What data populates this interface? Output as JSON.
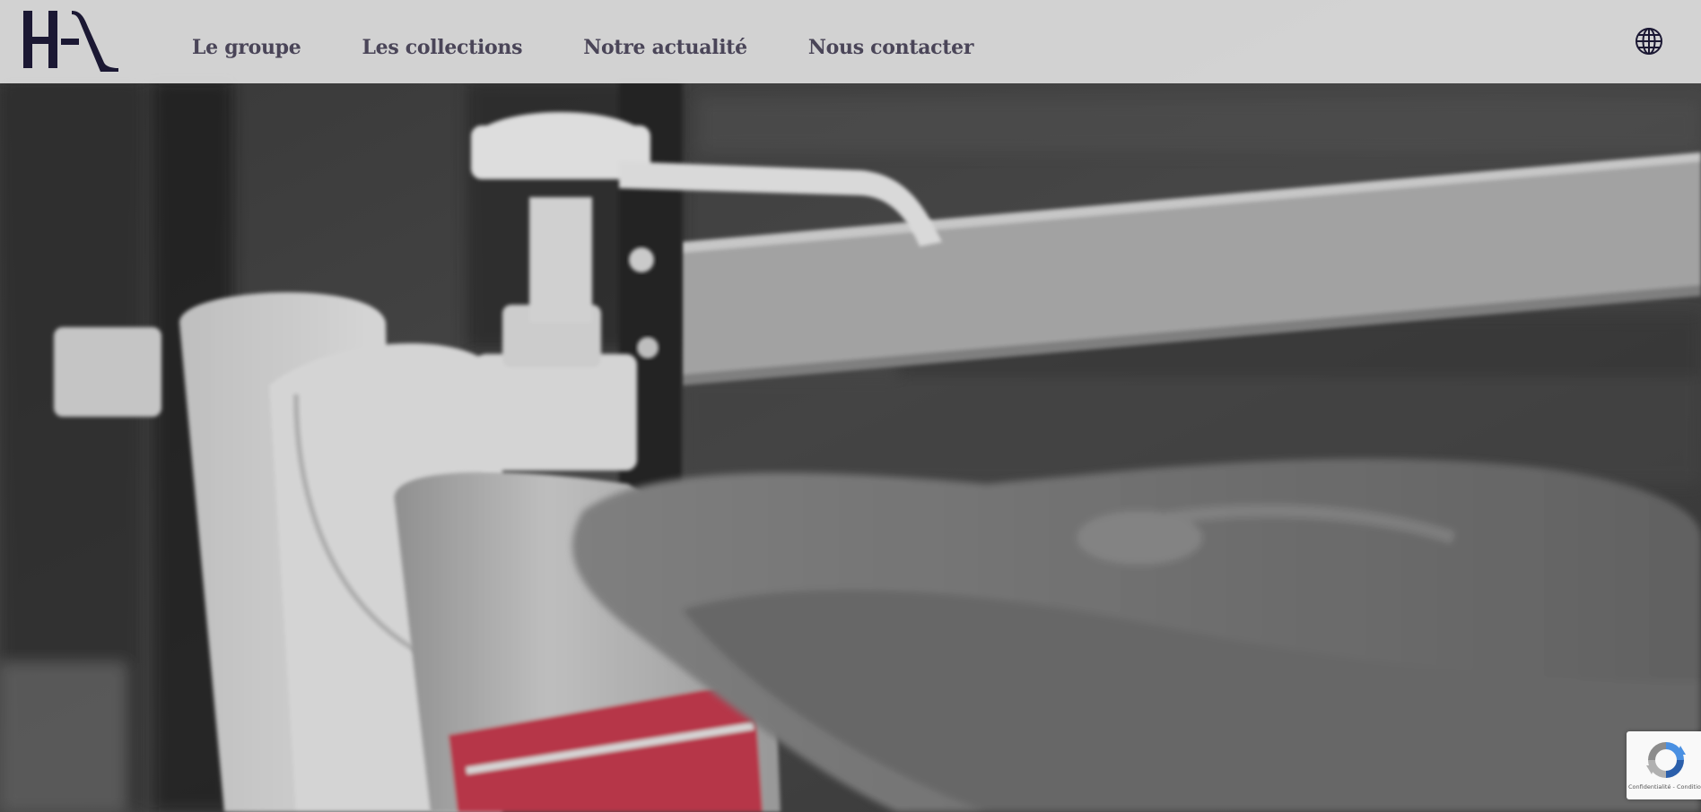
{
  "header": {
    "logo_text": "HA",
    "nav": [
      {
        "label": "Le groupe"
      },
      {
        "label": "Les collections"
      },
      {
        "label": "Notre actualité"
      },
      {
        "label": "Nous contacter"
      }
    ],
    "language_icon": "globe-icon"
  },
  "hero": {
    "image_subject": "hand-sanitizer-dispenser-grayscale-photo",
    "accent_color": "#c63a4f"
  },
  "recaptcha": {
    "icon": "recaptcha-icon",
    "privacy_label": "Confidentialité",
    "separator": " - ",
    "terms_label": "Conditions"
  },
  "colors": {
    "header_bg": "#dedede",
    "nav_text": "#4a4558",
    "logo": "#1b1833"
  }
}
